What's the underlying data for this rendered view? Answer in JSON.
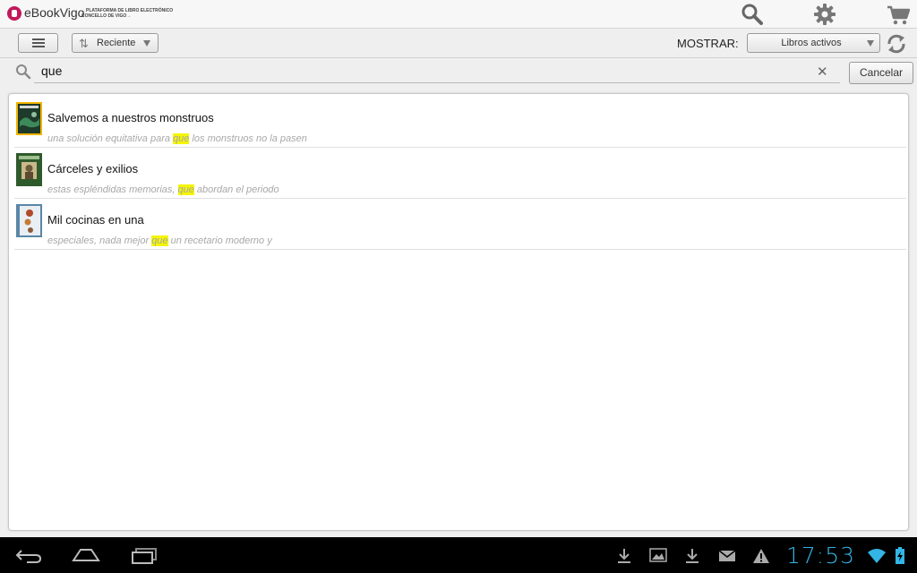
{
  "header": {
    "app_name": "eBookVigo",
    "tagline_line1": "←PLATAFORMA DE LIBRO ELECTRÓNICO",
    "tagline_line2": "CONCELLO DE VIGO→",
    "icons": [
      "search-icon",
      "gear-icon",
      "cart-icon"
    ],
    "brand_color": "#c2185b"
  },
  "toolbar": {
    "sort_label": "Reciente",
    "show_label": "MOSTRAR:",
    "filter_value": "Libros activos"
  },
  "search": {
    "query": "que",
    "cancel_label": "Cancelar"
  },
  "results": [
    {
      "title": "Salvemos a nuestros monstruos",
      "snippet_before": "una solución equitativa para ",
      "match": "que",
      "snippet_after": " los monstruos no la pasen"
    },
    {
      "title": "Cárceles y exilios",
      "snippet_before": "estas espléndidas memorias, ",
      "match": "que",
      "snippet_after": " abordan el periodo"
    },
    {
      "title": "Mil cocinas en una",
      "snippet_before": "especiales, nada mejor ",
      "match": "que",
      "snippet_after": " un recetario moderno y"
    }
  ],
  "highlight_color": "#f5f500",
  "system_bar": {
    "clock": "17:53",
    "clock_color": "#33b5e5"
  }
}
